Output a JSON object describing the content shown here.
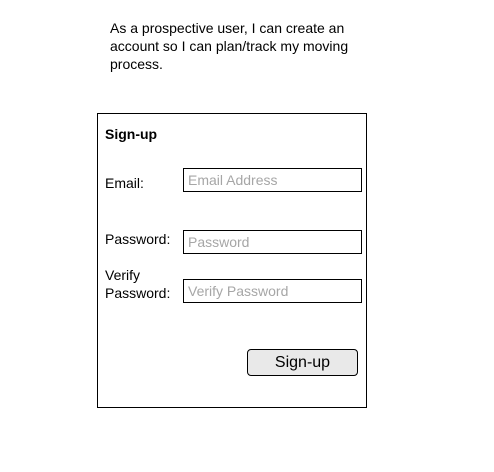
{
  "story": {
    "text": "As a prospective user, I can create an account so I can plan/track my moving process."
  },
  "form": {
    "title": "Sign-up",
    "email": {
      "label": "Email:",
      "value": "",
      "placeholder": "Email Address"
    },
    "password": {
      "label": "Password:",
      "value": "",
      "placeholder": "Password"
    },
    "verify_password": {
      "label": "Verify Password:",
      "value": "",
      "placeholder": "Verify Password"
    },
    "submit_label": "Sign-up"
  }
}
